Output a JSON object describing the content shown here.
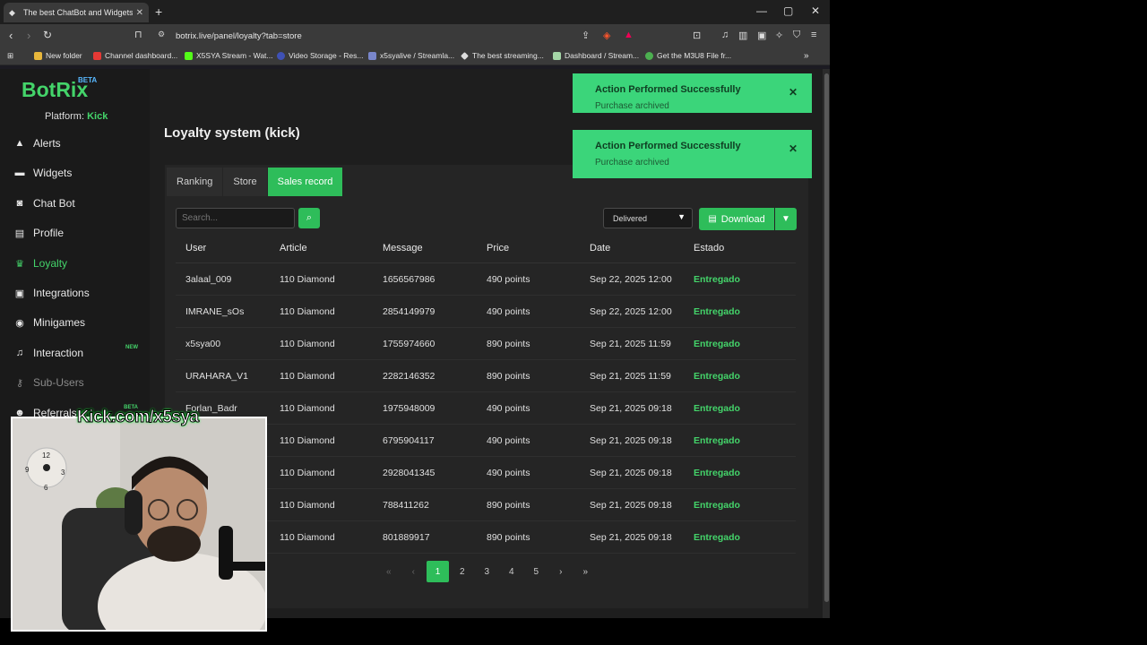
{
  "browser": {
    "tab_title": "The best ChatBot and Widgets f",
    "tab_close": "✕",
    "new_tab": "+",
    "url": "botrix.live/panel/loyalty?tab=store",
    "window_controls": [
      "—",
      "▢",
      "✕"
    ]
  },
  "bookmarks": [
    {
      "label": "New folder",
      "color": "#e8b73b"
    },
    {
      "label": "Channel dashboard...",
      "color": "#e53935"
    },
    {
      "label": "X5SYA Stream - Wat...",
      "color": "#53fc18"
    },
    {
      "label": "Video Storage - Res...",
      "color": "#3f51b5"
    },
    {
      "label": "x5syalive / Streamla...",
      "color": "#7986cb"
    },
    {
      "label": "The best streaming...",
      "color": "#dddddd"
    },
    {
      "label": "Dashboard / Stream...",
      "color": "#a5d6a7"
    },
    {
      "label": "Get the M3U8 File fr...",
      "color": "#4caf50"
    }
  ],
  "sidebar": {
    "logo": "BotRix",
    "logo_beta": "BETA",
    "platform_label": "Platform:",
    "platform_value": "Kick",
    "items": [
      {
        "label": "Alerts",
        "icon": "warning-icon"
      },
      {
        "label": "Widgets",
        "icon": "tv-icon"
      },
      {
        "label": "Chat Bot",
        "icon": "robot-icon"
      },
      {
        "label": "Profile",
        "icon": "id-card-icon"
      },
      {
        "label": "Loyalty",
        "icon": "trophy-icon"
      },
      {
        "label": "Integrations",
        "icon": "integrations-icon"
      },
      {
        "label": "Minigames",
        "icon": "gamepad-icon"
      },
      {
        "label": "Interaction",
        "icon": "music-icon",
        "badge": "NEW"
      },
      {
        "label": "Sub-Users",
        "icon": "key-icon"
      },
      {
        "label": "Referrals",
        "icon": "users-icon",
        "badge": "BETA"
      }
    ]
  },
  "main": {
    "title": "Loyalty system (kick)",
    "tabs": [
      "Ranking",
      "Store",
      "Sales record"
    ],
    "search_placeholder": "Search...",
    "status_filter": "Delivered",
    "download_label": "Download",
    "columns": [
      "User",
      "Article",
      "Message",
      "Price",
      "Date",
      "Estado"
    ],
    "rows": [
      [
        "3alaal_009",
        "110 Diamond",
        "1656567986",
        "490 points",
        "Sep 22, 2025 12:00",
        "Entregado"
      ],
      [
        "IMRANE_sOs",
        "110 Diamond",
        "2854149979",
        "490 points",
        "Sep 22, 2025 12:00",
        "Entregado"
      ],
      [
        "x5sya00",
        "110 Diamond",
        "1755974660",
        "890 points",
        "Sep 21, 2025 11:59",
        "Entregado"
      ],
      [
        "URAHARA_V1",
        "110 Diamond",
        "2282146352",
        "890 points",
        "Sep 21, 2025 11:59",
        "Entregado"
      ],
      [
        "Forlan_Badr",
        "110 Diamond",
        "1975948009",
        "490 points",
        "Sep 21, 2025 09:18",
        "Entregado"
      ],
      [
        "",
        "110 Diamond",
        "6795904117",
        "490 points",
        "Sep 21, 2025 09:18",
        "Entregado"
      ],
      [
        "",
        "110 Diamond",
        "2928041345",
        "490 points",
        "Sep 21, 2025 09:18",
        "Entregado"
      ],
      [
        "",
        "110 Diamond",
        "788411262",
        "890 points",
        "Sep 21, 2025 09:18",
        "Entregado"
      ],
      [
        "",
        "110 Diamond",
        "801889917",
        "890 points",
        "Sep 21, 2025 09:18",
        "Entregado"
      ]
    ],
    "pagination": [
      "«",
      "‹",
      "1",
      "2",
      "3",
      "4",
      "5",
      "›",
      "»"
    ]
  },
  "toasts": [
    {
      "title": "Action Performed Successfully",
      "message": "Purchase archived"
    },
    {
      "title": "Action Performed Successfully",
      "message": "Purchase archived"
    }
  ],
  "overlay": {
    "caption": "Kick.com/x5sya"
  }
}
